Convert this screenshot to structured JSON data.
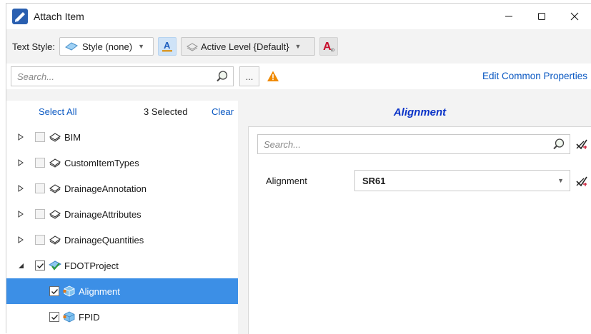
{
  "window": {
    "title": "Attach Item",
    "controls": {
      "minimize": "—",
      "maximize": "☐",
      "close": "✕"
    }
  },
  "toolbar": {
    "text_style_label": "Text Style:",
    "style_value": "Style (none)",
    "level_value": "Active Level {Default}"
  },
  "search": {
    "placeholder": "Search...",
    "more_label": "...",
    "edit_common_properties": "Edit Common Properties"
  },
  "left_pane": {
    "select_all": "Select All",
    "selected_count": "3 Selected",
    "clear": "Clear",
    "tree": [
      {
        "label": "BIM",
        "checked": false,
        "expanded": false
      },
      {
        "label": "CustomItemTypes",
        "checked": false,
        "expanded": false
      },
      {
        "label": "DrainageAnnotation",
        "checked": false,
        "expanded": false
      },
      {
        "label": "DrainageAttributes",
        "checked": false,
        "expanded": false
      },
      {
        "label": "DrainageQuantities",
        "checked": false,
        "expanded": false
      },
      {
        "label": "FDOTProject",
        "checked": true,
        "expanded": true,
        "children": [
          {
            "label": "Alignment",
            "checked": true,
            "selected": true
          },
          {
            "label": "FPID",
            "checked": true,
            "selected": false
          }
        ]
      }
    ]
  },
  "right_pane": {
    "title": "Alignment",
    "search_placeholder": "Search...",
    "property_label": "Alignment",
    "property_value": "SR61"
  },
  "colors": {
    "accent_link": "#0a58c2",
    "title_blue": "#0a33c8",
    "selection": "#3c8fe6",
    "warning": "#f08a00"
  }
}
